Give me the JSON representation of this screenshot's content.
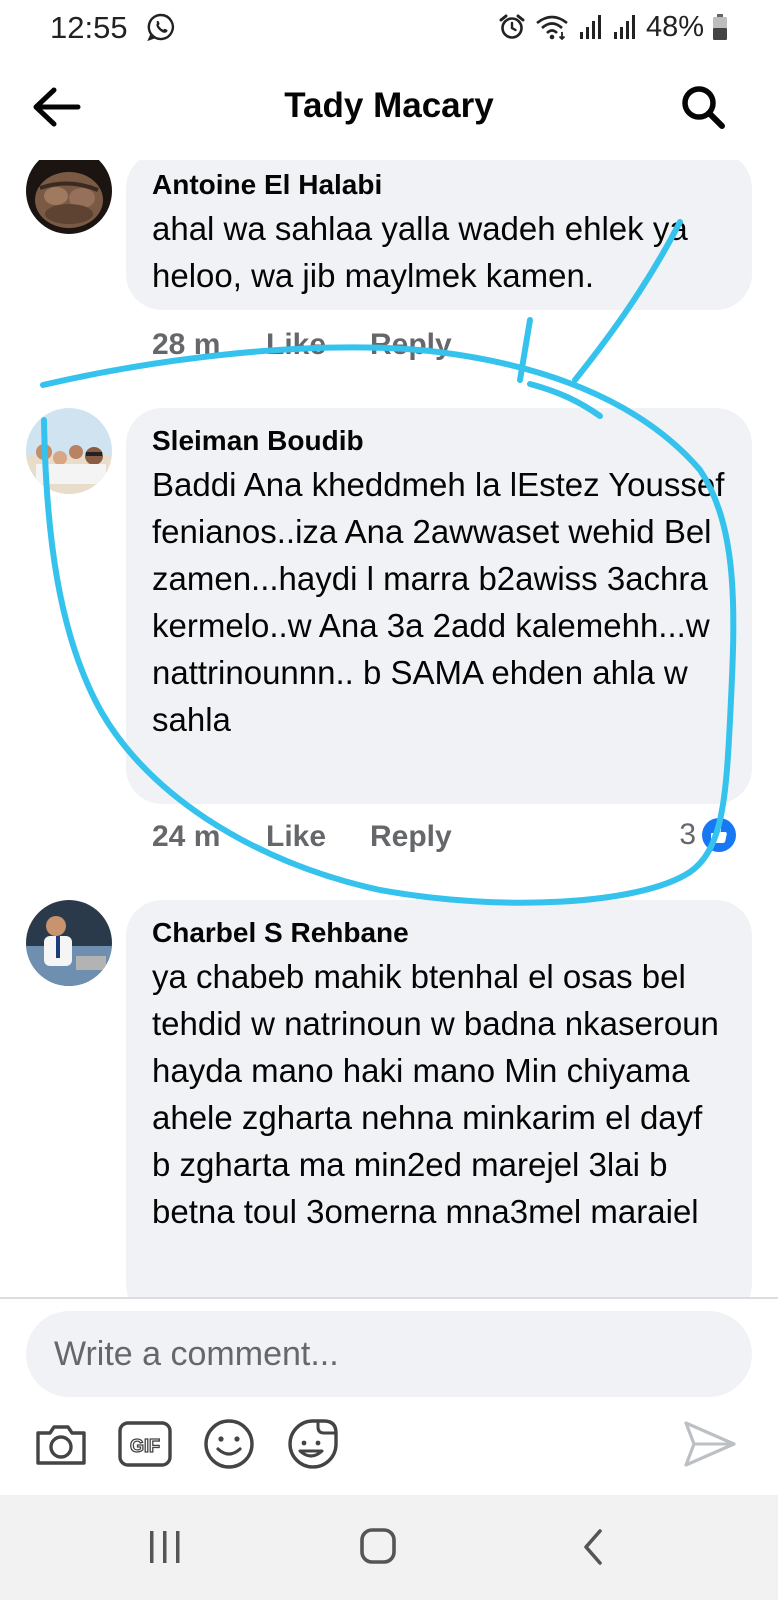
{
  "status_bar": {
    "time": "12:55",
    "battery_percent": "48%",
    "icons": [
      "whatsapp-icon",
      "alarm-icon",
      "wifi-icon",
      "signal-icon",
      "signal-icon",
      "battery-icon"
    ]
  },
  "header": {
    "title": "Tady Macary",
    "back_icon": "arrow-left-icon",
    "search_icon": "search-icon"
  },
  "comments": [
    {
      "author": "Antoine El Halabi",
      "text": "ahal wa sahlaa yalla wadeh ehlek ya heloo, wa jib maylmek kamen.",
      "time": "28 m",
      "like_label": "Like",
      "reply_label": "Reply"
    },
    {
      "author": "Sleiman Boudib",
      "text": "Baddi Ana kheddmeh la lEstez Youssef fenianos..iza Ana 2awwaset wehid Bel zamen...haydi l marra b2awiss 3achra kermelo..w Ana 3a 2add kalemehh...w nattrinounnn.. b SAMA ehden ahla w sahla",
      "time": "24 m",
      "like_label": "Like",
      "reply_label": "Reply",
      "reaction_count": "3"
    },
    {
      "author": "Charbel S Rehbane",
      "text": "ya chabeb mahik btenhal el osas bel tehdid w natrinoun w badna nkaseroun hayda mano haki mano Min chiyama ahele zgharta nehna minkarim el dayf b zgharta ma min2ed marejel 3lai b betna toul 3omerna mna3mel maraiel"
    }
  ],
  "composer": {
    "placeholder": "Write a comment...",
    "tools": [
      "camera-icon",
      "gif-icon",
      "emoji-icon",
      "sticker-icon"
    ],
    "send_icon": "send-icon"
  },
  "navbar": {
    "icons": [
      "recent-apps-icon",
      "home-icon",
      "back-icon"
    ]
  },
  "colors": {
    "bubble": "#f0f2f5",
    "meta_text": "#65676b",
    "like_blue": "#1877f2",
    "annotation_stroke": "#35c3ee"
  }
}
